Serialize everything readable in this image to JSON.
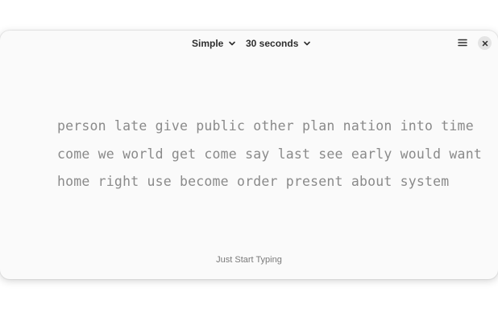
{
  "header": {
    "mode_label": "Simple",
    "duration_label": "30 seconds"
  },
  "words": {
    "line1": "person late give public other plan nation into time",
    "line2": "come we world get come say last see early would want",
    "line3": "home right use become order present about system"
  },
  "hint": "Just Start Typing",
  "icons": {
    "mode_chevron": "chevron-down-icon",
    "duration_chevron": "chevron-down-icon",
    "menu": "hamburger-menu-icon",
    "close": "close-icon"
  },
  "colors": {
    "window_bg": "#fafafa",
    "word_text": "#8a8a8a",
    "close_bg": "#e4e4e4"
  }
}
